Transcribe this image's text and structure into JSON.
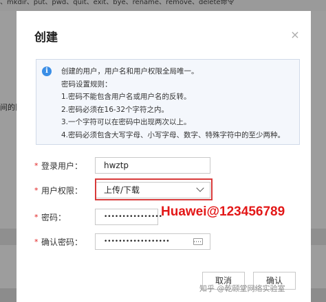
{
  "background": {
    "top_text": "、mkdir、put、pwd、quit、exit、bye、rename、remove、delete命令",
    "left_text": "间的限"
  },
  "dialog": {
    "title": "创建",
    "info_lines": [
      "创建的用户，用户名和用户权限全局唯一。",
      "密码设置规则：",
      "1.密码不能包含用户名或用户名的反转。",
      "2.密码必须在16-32个字符之内。",
      "3.一个字符可以在密码中出现两次以上。",
      "4.密码必须包含大写字母、小写字母、数字、特殊字符中的至少两种。"
    ],
    "fields": {
      "username_label": "登录用户：",
      "username_value": "hwztp",
      "permission_label": "用户权限：",
      "permission_value": "上传/下载",
      "password_label": "密码：",
      "password_value": "••••••••••••••••",
      "confirm_label": "确认密码：",
      "confirm_value": "••••••••••••••••••",
      "required_mark": "*"
    },
    "buttons": {
      "cancel": "取消",
      "ok": "确认"
    }
  },
  "overlay_text": "Huawei@123456789",
  "watermark": "知乎 @乾颐堂网络实验室",
  "colors": {
    "required": "#e02020",
    "highlight_box": "#d83a3a",
    "overlay": "#e31818",
    "info_icon": "#3a8ee6"
  }
}
